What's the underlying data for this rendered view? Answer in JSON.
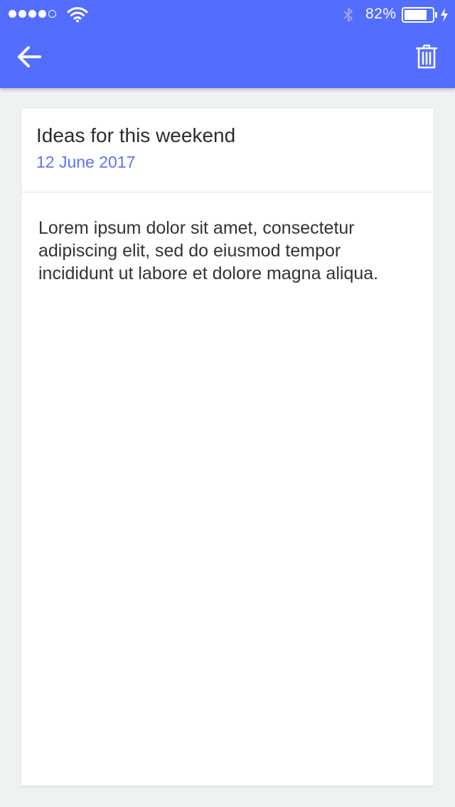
{
  "status_bar": {
    "signal_icon": "signal-dots-icon",
    "wifi_icon": "wifi-icon",
    "bluetooth_icon": "bluetooth-icon",
    "battery_percent": "82%",
    "battery_level": 0.82,
    "charging_icon": "lightning-icon"
  },
  "app_bar": {
    "background_color": "#536dfe",
    "back_icon": "arrow-left-icon",
    "delete_icon": "trash-icon"
  },
  "note": {
    "title": "Ideas for this weekend",
    "date": "12 June 2017",
    "body": "Lorem ipsum dolor sit amet, consectetur adipiscing elit, sed do eiusmod tempor incididunt ut labore et dolore magna aliqua."
  }
}
